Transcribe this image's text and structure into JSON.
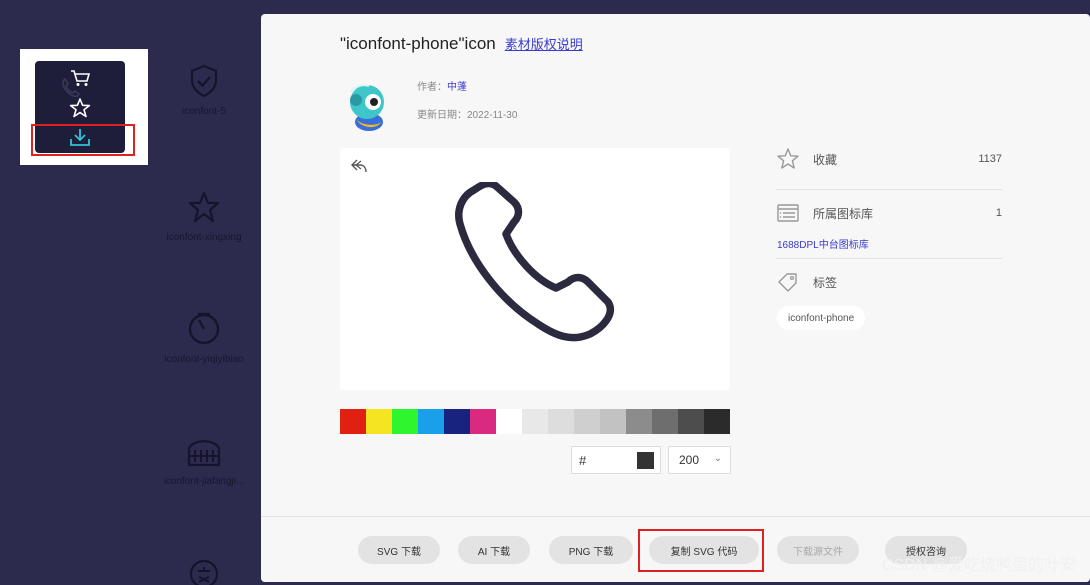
{
  "background": {
    "cells": [
      {
        "label": "iconfont-5",
        "icon": "shield-check-icon"
      },
      {
        "label": "iconfont-xingxing",
        "icon": "star-icon"
      },
      {
        "label": "iconfont-yiqiyibiao",
        "icon": "gauge-icon"
      },
      {
        "label": "iconfont-jiafangji...",
        "icon": "building-icon"
      },
      {
        "label": "",
        "icon": "ke-badge-icon"
      }
    ]
  },
  "card_actions": [
    "cart-icon",
    "star-icon",
    "download-icon"
  ],
  "modal": {
    "title": "\"iconfont-phone\"icon",
    "license_link": "素材版权说明",
    "author_label": "作者：",
    "author_name": "中蓬",
    "updated_label": "更新日期：",
    "updated_date": "2022-11-30",
    "stats": {
      "favorites_label": "收藏",
      "favorites_count": "1137",
      "library_label": "所属图标库",
      "library_count": "1",
      "library_name": "1688DPL中台图标库",
      "tags_label": "标签",
      "tag": "iconfont-phone"
    },
    "hex_prefix": "#",
    "hex_value": "",
    "size_value": "200",
    "swatches": [
      "#e02010",
      "#f5e421",
      "#2ef52e",
      "#1aa0e8",
      "#18227f",
      "#da2a7f",
      "#ffffff",
      "#e8e8e8",
      "#dddddd",
      "#cfcfcf",
      "#c2c2c2",
      "#8c8c8c",
      "#6e6e6e",
      "#4d4d4d",
      "#2b2b2b"
    ],
    "buttons": [
      {
        "label": "SVG 下载",
        "disabled": false
      },
      {
        "label": "AI 下载",
        "disabled": false
      },
      {
        "label": "PNG 下载",
        "disabled": false
      },
      {
        "label": "复制 SVG 代码",
        "disabled": false
      },
      {
        "label": "下载源文件",
        "disabled": true
      },
      {
        "label": "授权咨询",
        "disabled": false
      }
    ]
  },
  "watermark": "CSDN @爱吃烧鸭蛋的叶安",
  "colors": {
    "link": "#3a3ad0",
    "overlay": "#2c2b4e",
    "highlight": "#e02020"
  }
}
